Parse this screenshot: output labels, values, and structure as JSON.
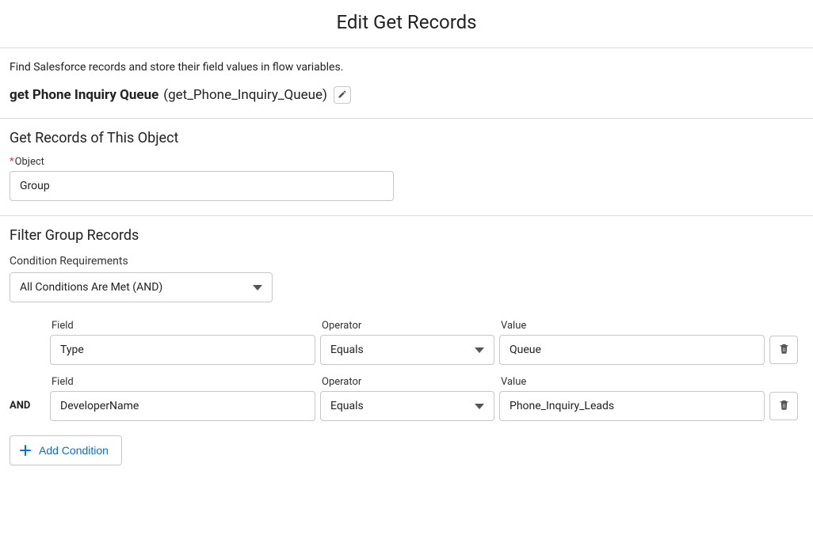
{
  "title": "Edit Get Records",
  "description": "Find Salesforce records and store their field values in flow variables.",
  "record": {
    "label": "get Phone Inquiry Queue",
    "api_name": "(get_Phone_Inquiry_Queue)"
  },
  "sections": {
    "object_title": "Get Records of This Object",
    "filter_title": "Filter Group Records"
  },
  "object_field": {
    "label": "Object",
    "value": "Group"
  },
  "condition_requirements": {
    "label": "Condition Requirements",
    "value": "All Conditions Are Met (AND)"
  },
  "headers": {
    "field": "Field",
    "operator": "Operator",
    "value": "Value"
  },
  "rows": [
    {
      "logic": "",
      "field": "Type",
      "operator": "Equals",
      "value": "Queue"
    },
    {
      "logic": "AND",
      "field": "DeveloperName",
      "operator": "Equals",
      "value": "Phone_Inquiry_Leads"
    }
  ],
  "add_condition_label": "Add Condition"
}
